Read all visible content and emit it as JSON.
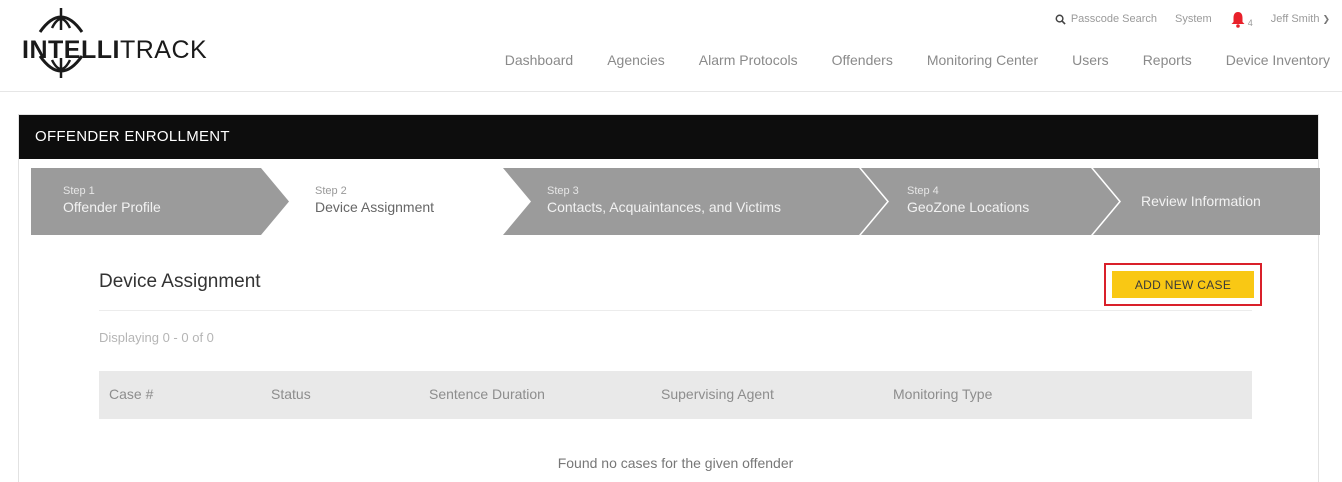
{
  "logo": {
    "bold": "INTELLI",
    "light": "TRACK"
  },
  "utility": {
    "passcode_search": "Passcode Search",
    "system": "System",
    "notification_count": "4",
    "user_name": "Jeff Smith"
  },
  "nav": [
    "Dashboard",
    "Agencies",
    "Alarm Protocols",
    "Offenders",
    "Monitoring Center",
    "Users",
    "Reports",
    "Device Inventory"
  ],
  "panel": {
    "title": "OFFENDER ENROLLMENT"
  },
  "steps": [
    {
      "num": "Step 1",
      "label": "Offender Profile"
    },
    {
      "num": "Step 2",
      "label": "Device Assignment"
    },
    {
      "num": "Step 3",
      "label": "Contacts, Acquaintances, and Victims"
    },
    {
      "num": "Step 4",
      "label": "GeoZone Locations"
    },
    {
      "num": "",
      "label": "Review Information"
    }
  ],
  "section": {
    "title": "Device Assignment",
    "add_button": "ADD NEW CASE",
    "displaying": "Displaying 0 - 0 of 0",
    "columns": [
      "Case #",
      "Status",
      "Sentence Duration",
      "Supervising Agent",
      "Monitoring Type"
    ],
    "empty_message": "Found no cases for the given offender"
  },
  "colors": {
    "header_bar": "#0d0d0d",
    "step_inactive": "#9b9b9b",
    "step_active": "#ffffff",
    "accent_button": "#f9c814",
    "highlight_border": "#d9202a",
    "bell": "#e8202a"
  }
}
